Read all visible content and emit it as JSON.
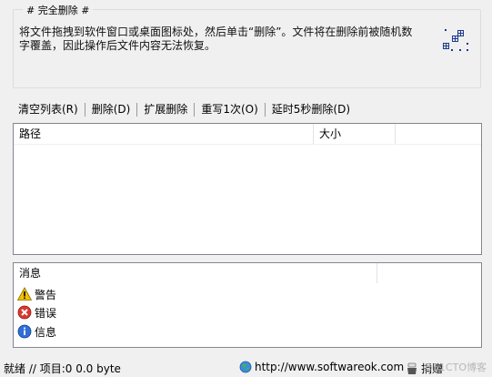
{
  "group": {
    "title": "# 完全删除 #",
    "description": "将文件拖拽到软件窗口或桌面图标处，然后单击“删除”。文件将在删除前被随机数字覆盖，因此操作后文件内容无法恢复。",
    "icon": "drop-target-icon"
  },
  "toolbar": {
    "clear": "清空列表(R)",
    "delete": "删除(D)",
    "extended_delete": "扩展删除",
    "overwrite": "重写1次(O)",
    "delayed_delete": "延时5秒删除(D)"
  },
  "file_list": {
    "columns": [
      "路径",
      "大小"
    ],
    "rows": []
  },
  "messages": {
    "header": "消息",
    "items": [
      {
        "icon": "warning-icon",
        "label": "警告",
        "color": "#f2c200"
      },
      {
        "icon": "error-icon",
        "label": "错误",
        "color": "#d83a2e"
      },
      {
        "icon": "info-icon",
        "label": "信息",
        "color": "#2f6fd6"
      }
    ]
  },
  "status": {
    "text": "就绪 // 项目:0 0.0 byte",
    "url": "http://www.softwareok.com",
    "donate": "捐赠"
  },
  "watermark": "@51CTO博客"
}
